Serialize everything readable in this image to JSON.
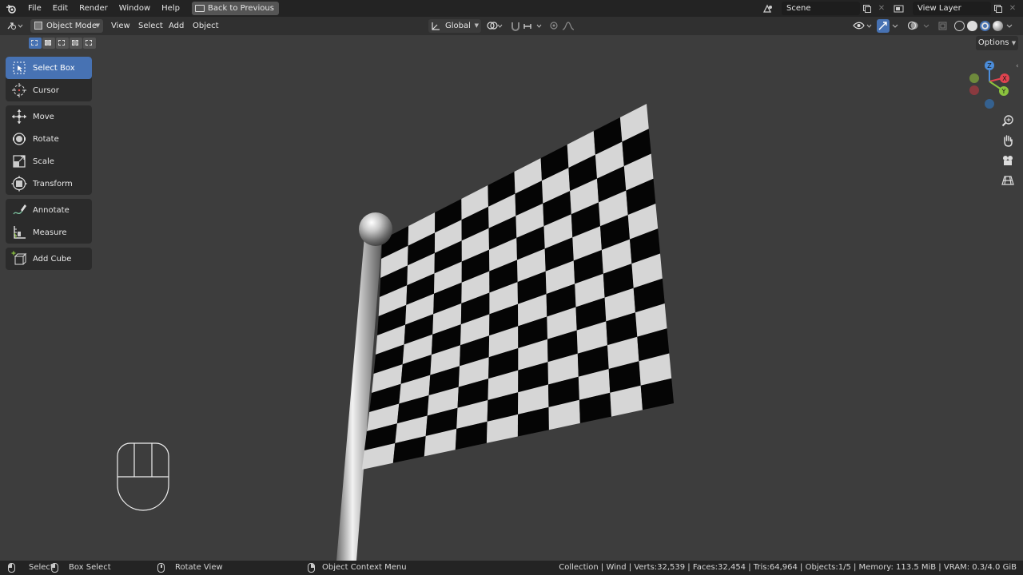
{
  "menu": {
    "items": [
      "File",
      "Edit",
      "Render",
      "Window",
      "Help"
    ],
    "back_button": "Back to Previous"
  },
  "scene": {
    "name": "Scene",
    "view_layer": "View Layer"
  },
  "viewport_header": {
    "mode": "Object Mode",
    "menus": [
      "View",
      "Select",
      "Add",
      "Object"
    ],
    "orientation": "Global",
    "options_label": "Options"
  },
  "tools": [
    {
      "label": "Select Box",
      "icon": "select-box-icon",
      "active": true
    },
    {
      "label": "Cursor",
      "icon": "cursor-icon"
    },
    {
      "label": "Move",
      "icon": "move-icon"
    },
    {
      "label": "Rotate",
      "icon": "rotate-icon"
    },
    {
      "label": "Scale",
      "icon": "scale-icon"
    },
    {
      "label": "Transform",
      "icon": "transform-icon"
    },
    {
      "label": "Annotate",
      "icon": "annotate-icon"
    },
    {
      "label": "Measure",
      "icon": "measure-icon"
    },
    {
      "label": "Add Cube",
      "icon": "add-cube-icon"
    }
  ],
  "gizmo": {
    "x": "X",
    "y": "Y",
    "z": "Z"
  },
  "status": {
    "select": "Select",
    "box_select": "Box Select",
    "rotate_view": "Rotate View",
    "context_menu": "Object Context Menu",
    "stats": "Collection | Wind | Verts:32,539 | Faces:32,454 | Tris:64,964 | Objects:1/5 | Memory: 113.5 MiB | VRAM: 0.3/4.0 GiB"
  },
  "colors": {
    "accent": "#4772b3",
    "axis_x": "#e0434f",
    "axis_y": "#8bc33e",
    "axis_z": "#4b8ddb"
  }
}
